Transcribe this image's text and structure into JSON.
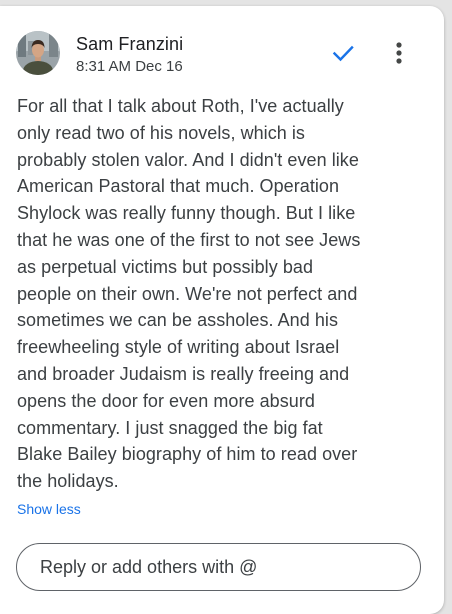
{
  "comment": {
    "author": "Sam Franzini",
    "timestamp": "8:31 AM Dec 16",
    "body": "For all that I talk about Roth, I've actually\nonly read two of his novels, which is\nprobably stolen valor. And I didn't even like\nAmerican Pastoral that much. Operation\nShylock was really funny though. But I like\nthat he was one of the first to not see Jews\nas perpetual victims but possibly bad\npeople on their own. We're not perfect and\nsometimes we can be assholes. And his\nfreewheeling style of writing about Israel\nand broader Judaism is really freeing and\nopens the door for even more absurd\ncommentary. I just snagged the big fat\nBlake Bailey biography of him to read over\nthe holidays.",
    "toggle_label": "Show less",
    "resolve_icon": "checkmark-icon",
    "more_icon": "more-vert-icon"
  },
  "reply": {
    "placeholder": "Reply or add others with @",
    "value": ""
  },
  "colors": {
    "accent": "#1a73e8",
    "text": "#3c4043",
    "name": "#202124",
    "border": "#5f6368"
  }
}
